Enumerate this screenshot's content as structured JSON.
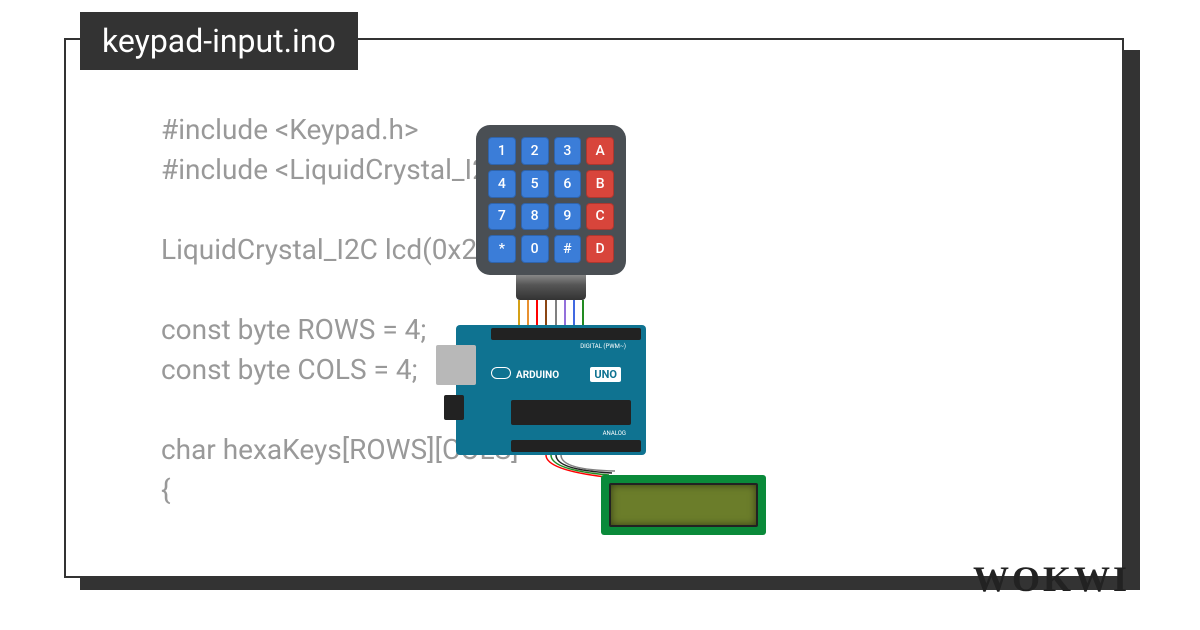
{
  "title": "keypad-input.ino",
  "code": "#include <Keypad.h>\n#include <LiquidCrystal_I2C\n\nLiquidCrystal_I2C lcd(0x27,\n\nconst byte ROWS = 4;\nconst byte COLS = 4;\n\nchar hexaKeys[ROWS][COLS] =\n{",
  "keypad": {
    "keys": [
      {
        "label": "1",
        "color": "blue"
      },
      {
        "label": "2",
        "color": "blue"
      },
      {
        "label": "3",
        "color": "blue"
      },
      {
        "label": "A",
        "color": "red"
      },
      {
        "label": "4",
        "color": "blue"
      },
      {
        "label": "5",
        "color": "blue"
      },
      {
        "label": "6",
        "color": "blue"
      },
      {
        "label": "B",
        "color": "red"
      },
      {
        "label": "7",
        "color": "blue"
      },
      {
        "label": "8",
        "color": "blue"
      },
      {
        "label": "9",
        "color": "blue"
      },
      {
        "label": "C",
        "color": "red"
      },
      {
        "label": "*",
        "color": "blue"
      },
      {
        "label": "0",
        "color": "blue"
      },
      {
        "label": "#",
        "color": "blue"
      },
      {
        "label": "D",
        "color": "red"
      }
    ]
  },
  "arduino": {
    "brand": "ARDUINO",
    "model": "UNO",
    "pwm_label": "DIGITAL (PWM~)",
    "analog_label": "ANALOG"
  },
  "wire_colors": [
    "#d4a017",
    "#e89030",
    "#ff0000",
    "#8b4513",
    "#808080",
    "#9370db",
    "#4169e1",
    "#228b22"
  ],
  "logo": "WOKWI"
}
